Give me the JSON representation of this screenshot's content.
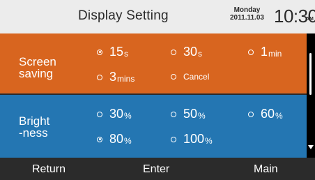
{
  "header": {
    "title": "Display Setting",
    "day": "Monday",
    "date": "2011.11.03",
    "time": "10:30",
    "ampm": "AM"
  },
  "screen_saving": {
    "label_line1": "Screen",
    "label_line2": "saving",
    "options": [
      {
        "value": "15",
        "unit": "s",
        "checked": true
      },
      {
        "value": "30",
        "unit": "s",
        "checked": false
      },
      {
        "value": "1",
        "unit": "min",
        "checked": false
      },
      {
        "value": "3",
        "unit": "mins",
        "checked": false
      },
      {
        "value": "Cancel",
        "unit": "",
        "checked": false
      }
    ]
  },
  "brightness": {
    "label_line1": "Bright",
    "label_line2": "-ness",
    "options": [
      {
        "value": "30",
        "unit": "%",
        "checked": false
      },
      {
        "value": "50",
        "unit": "%",
        "checked": false
      },
      {
        "value": "60",
        "unit": "%",
        "checked": false
      },
      {
        "value": "80",
        "unit": "%",
        "checked": true
      },
      {
        "value": "100",
        "unit": "%",
        "checked": false
      }
    ]
  },
  "footer": {
    "return_label": "Return",
    "enter_label": "Enter",
    "main_label": "Main"
  },
  "colors": {
    "screen_saving_bg": "#d8651f",
    "brightness_bg": "#2476b2",
    "header_bg": "#ececec",
    "footer_bg": "#2b2b2b"
  }
}
